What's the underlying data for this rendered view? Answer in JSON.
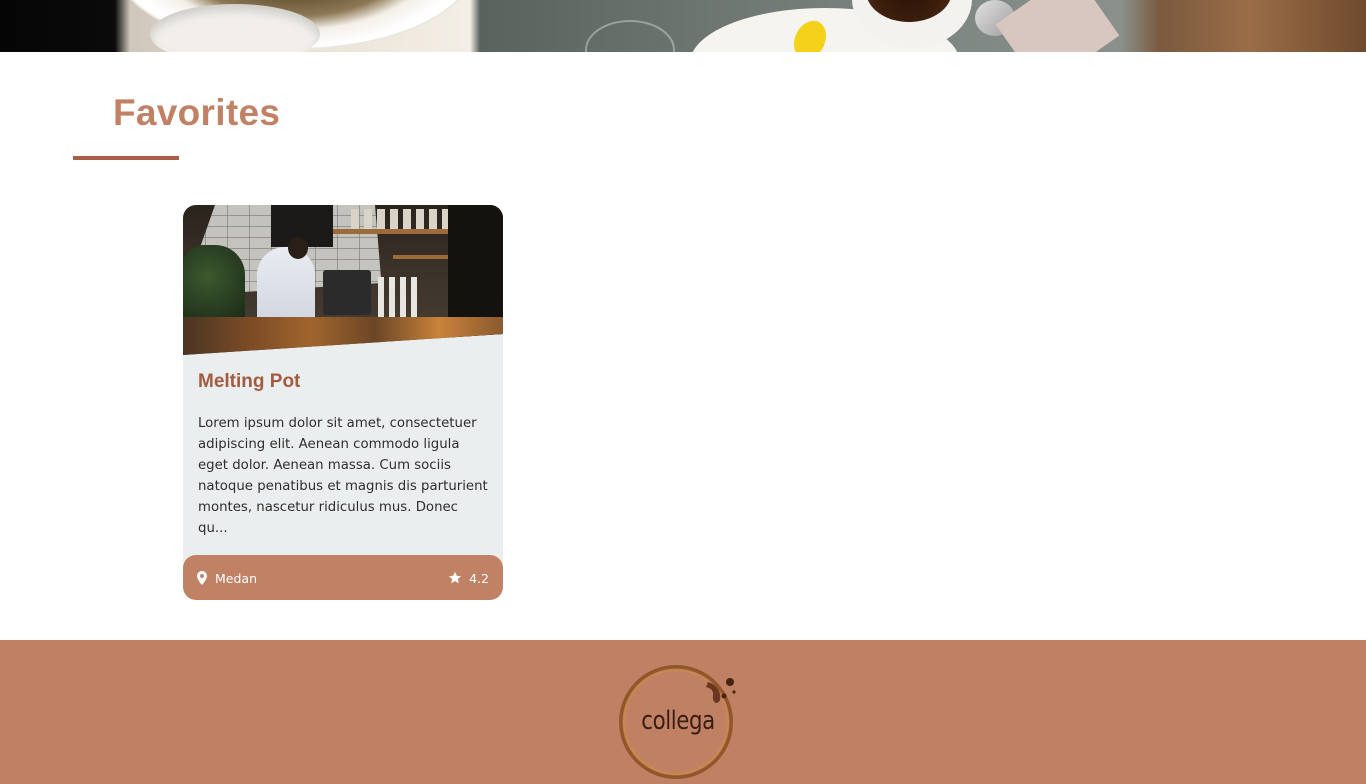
{
  "favorites": {
    "title": "Favorites"
  },
  "card": {
    "title": "Melting Pot",
    "description": "Lorem ipsum dolor sit amet, consectetuer adipiscing elit. Aenean commodo ligula eget dolor. Aenean massa. Cum sociis natoque penatibus et magnis dis parturient montes, nascetur ridiculus mus. Donec qu...",
    "location": "Medan",
    "rating": "4.2",
    "location_icon": "map-pin-icon",
    "rating_icon": "star-icon"
  },
  "footer": {
    "logo_text": "collega"
  },
  "colors": {
    "accent": "#c08165",
    "accent_dark": "#a85f43",
    "card_bg": "#ebeeef",
    "footer_bg": "#bf8064"
  }
}
